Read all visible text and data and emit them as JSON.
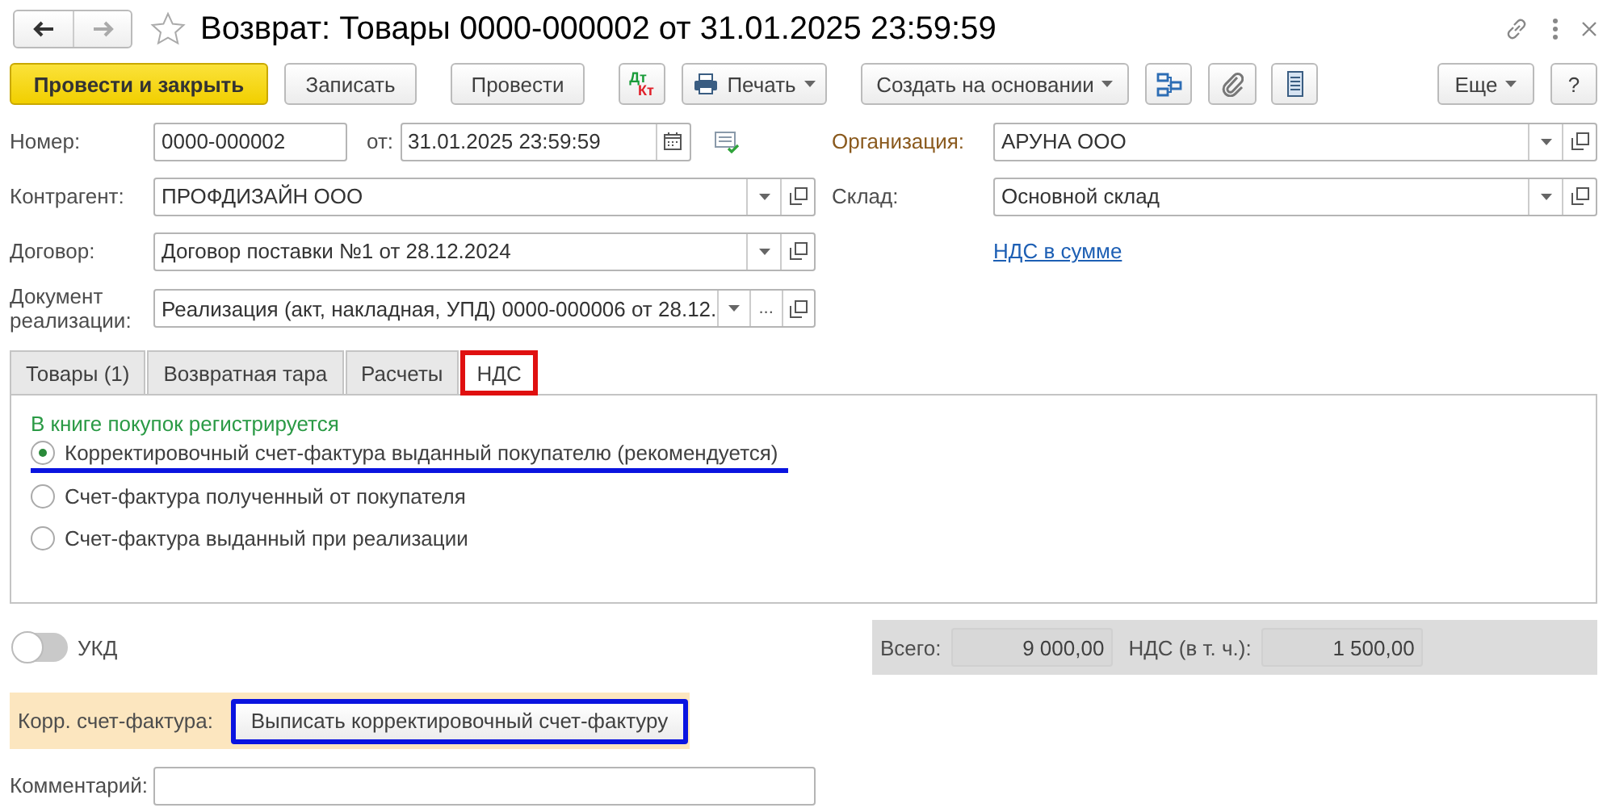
{
  "window": {
    "title": "Возврат: Товары 0000-000002 от 31.01.2025 23:59:59"
  },
  "navigation": {
    "back_disabled": false,
    "forward_disabled": true
  },
  "toolbar": [
    {
      "kind": "primary",
      "label": "Провести и закрыть"
    },
    {
      "kind": "button",
      "label": "Записать"
    },
    {
      "kind": "button",
      "label": "Провести"
    },
    {
      "kind": "dtkt",
      "dt": "Дт",
      "kt": "Кт"
    },
    {
      "kind": "print",
      "label": "Печать"
    },
    {
      "kind": "menu",
      "label": "Создать на основании"
    },
    {
      "kind": "structure"
    },
    {
      "kind": "clip"
    },
    {
      "kind": "list"
    }
  ],
  "toolbar_right": [
    {
      "kind": "menu",
      "label": "Еще"
    },
    {
      "kind": "button",
      "label": "?"
    }
  ],
  "number": {
    "label": "Номер:",
    "value": "0000-000002"
  },
  "date": {
    "label": "от:",
    "value": "31.01.2025 23:59:59"
  },
  "counterparty": {
    "label": "Контрагент:",
    "value": "ПРОФДИЗАЙН ООО",
    "buttons": [
      {
        "kind": "dropdown"
      },
      {
        "kind": "open"
      }
    ]
  },
  "contract": {
    "label": "Договор:",
    "value": "Договор поставки №1 от 28.12.2024",
    "buttons": [
      {
        "kind": "dropdown"
      },
      {
        "kind": "open"
      }
    ]
  },
  "sale_document": {
    "label": "Документ реализации:",
    "value": "Реализация (акт, накладная, УПД) 0000-000006 от 28.12.",
    "buttons": [
      {
        "kind": "dropdown"
      },
      {
        "kind": "ellipsis",
        "label": "..."
      },
      {
        "kind": "open"
      }
    ]
  },
  "organization": {
    "label": "Организация:",
    "value": "АРУНА ООО",
    "buttons": [
      {
        "kind": "dropdown"
      },
      {
        "kind": "open"
      }
    ]
  },
  "warehouse": {
    "label": "Склад:",
    "value": "Основной склад",
    "buttons": [
      {
        "kind": "dropdown"
      },
      {
        "kind": "open"
      }
    ]
  },
  "vat_link": "НДС в сумме",
  "tabs": [
    {
      "label": "Товары (1)",
      "selected": false,
      "highlighted": false
    },
    {
      "label": "Возвратная тара",
      "selected": false,
      "highlighted": false
    },
    {
      "label": "Расчеты",
      "selected": false,
      "highlighted": false
    },
    {
      "label": "НДС",
      "selected": true,
      "highlighted": true
    }
  ],
  "vat_panel": {
    "heading": "В книге покупок регистрируется",
    "options": [
      {
        "label": "Корректировочный счет-фактура выданный покупателю (рекомендуется)",
        "selected": true,
        "underlined": true
      },
      {
        "label": "Счет-фактура полученный от покупателя",
        "selected": false,
        "underlined": false
      },
      {
        "label": "Счет-фактура выданный при реализации",
        "selected": false,
        "underlined": false
      }
    ]
  },
  "ukd": {
    "label": "УКД",
    "on": false
  },
  "totals": [
    {
      "label": "Всего:",
      "value": "9 000,00"
    },
    {
      "label": "НДС (в т. ч.):",
      "value": "1 500,00"
    }
  ],
  "correction": {
    "label": "Корр. счет-фактура:",
    "button": "Выписать корректировочный счет-фактуру",
    "highlighted": true
  },
  "comment": {
    "label": "Комментарий:"
  }
}
